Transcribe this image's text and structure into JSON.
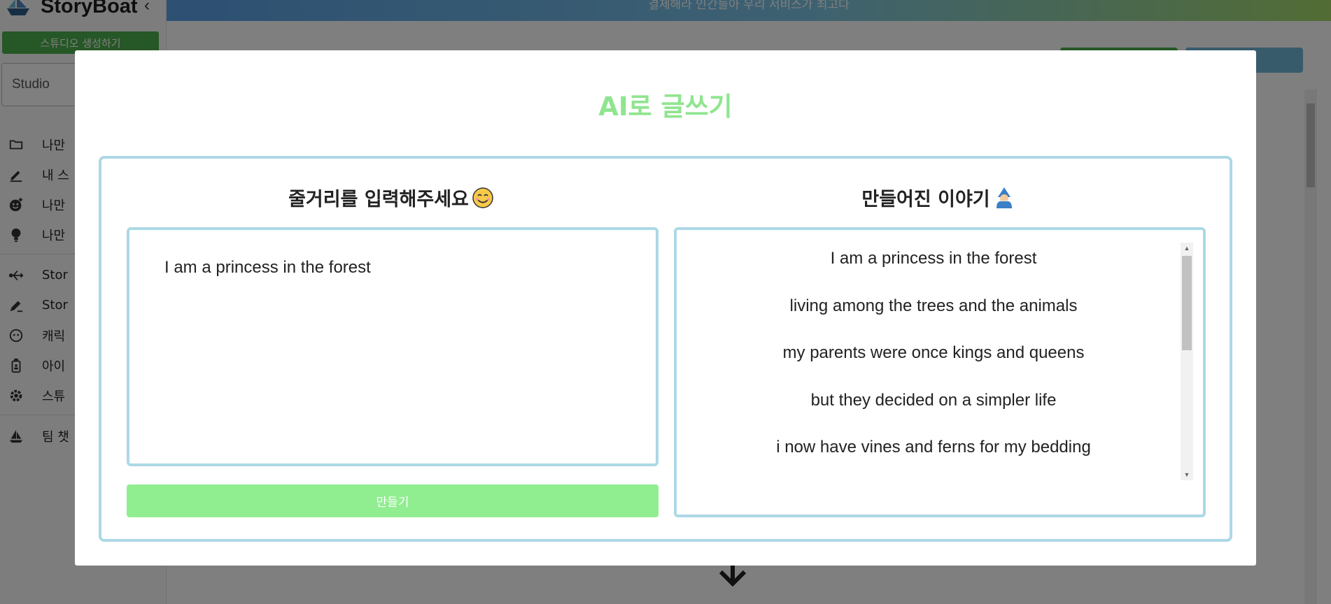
{
  "app": {
    "brand": "StoryBoat",
    "banner": "결제해라 인간들아 우리 서비스가 최고다"
  },
  "sidebar": {
    "create_studio_label": "스튜디오 생성하기",
    "studio_select_value": "Studio",
    "items": [
      {
        "label": "나만",
        "icon": "folder-icon"
      },
      {
        "label": "내 스",
        "icon": "pencil-icon"
      },
      {
        "label": "나만",
        "icon": "emoji-add-icon"
      },
      {
        "label": "나만",
        "icon": "lightbulb-icon"
      },
      {
        "label": "Stor",
        "icon": "branch-icon"
      },
      {
        "label": "Stor",
        "icon": "edit-icon"
      },
      {
        "label": "캐릭",
        "icon": "character-face-icon"
      },
      {
        "label": "아이",
        "icon": "item-bottle-icon"
      },
      {
        "label": "스튜",
        "icon": "gear-icon"
      },
      {
        "label": "팀 챗",
        "icon": "sailboat-icon"
      }
    ]
  },
  "modal": {
    "title": "AI로 글쓰기",
    "input_heading": "줄거리를 입력해주세요",
    "input_heading_icon": "smiling-face-emoji",
    "input_value": "I am a princess in the forest",
    "make_button_label": "만들기",
    "output_heading": "만들어진 이야기",
    "output_heading_icon": "mage-emoji",
    "story_lines": [
      "I am a princess in the forest",
      "living among the trees and the animals",
      "my parents were once kings and queens",
      "but they decided on a simpler life",
      "i now have vines and ferns for my bedding"
    ]
  },
  "colors": {
    "accent_green": "#90ee90",
    "frame_blue": "#add8e6",
    "primary_green": "#4cae4c"
  }
}
